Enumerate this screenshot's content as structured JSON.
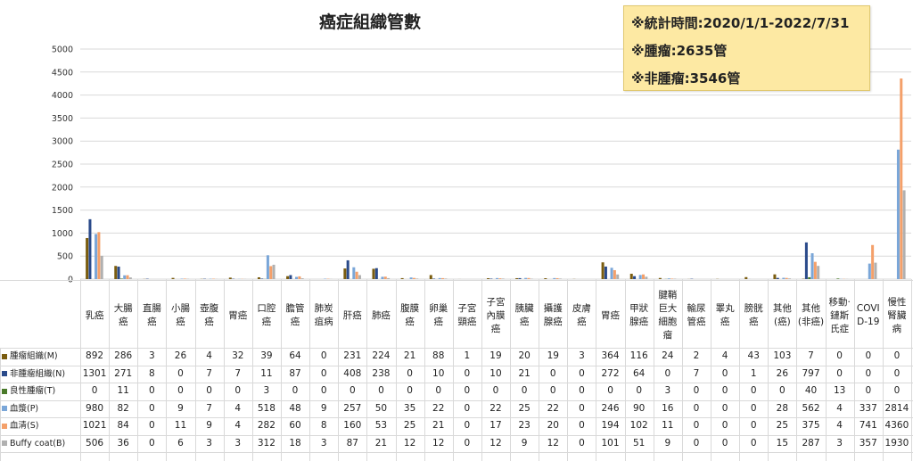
{
  "title": "癌症組織管數",
  "info": {
    "line1": "※統計時間:2020/1/1-2022/7/31",
    "line2": "※腫瘤:2635管",
    "line3": "※非腫瘤:3546管"
  },
  "chart_data": {
    "type": "bar",
    "title": "癌症組織管數",
    "ylim": [
      0,
      5000
    ],
    "yticks": [
      0,
      500,
      1000,
      1500,
      2000,
      2500,
      3000,
      3500,
      4000,
      4500,
      5000
    ],
    "grid": true,
    "legend": "table-left",
    "categories": [
      "乳癌",
      "大腸癌",
      "直腸癌",
      "小腸癌",
      "壺腹癌",
      "胃癌",
      "口腔癌",
      "膽管癌",
      "肺炭疽病",
      "肝癌",
      "肺癌",
      "腹膜癌",
      "卵巢癌",
      "子宮頸癌",
      "子宮內膜癌",
      "胰臟癌",
      "攝護腺癌",
      "皮膚癌",
      "胃癌",
      "甲狀腺癌",
      "腱鞘巨大細胞瘤",
      "輸尿管癌",
      "睪丸癌",
      "膀胱癌",
      "其他(癌)",
      "其他(非癌)",
      "移動·鏈斯氏症",
      "COVID-19",
      "慢性腎臟病"
    ],
    "category_lines": [
      [
        "乳癌"
      ],
      [
        "大腸",
        "癌"
      ],
      [
        "直腸",
        "癌"
      ],
      [
        "小腸",
        "癌"
      ],
      [
        "壺腹",
        "癌"
      ],
      [
        "胃癌"
      ],
      [
        "口腔",
        "癌"
      ],
      [
        "膽管",
        "癌"
      ],
      [
        "肺炭",
        "疽病"
      ],
      [
        "肝癌"
      ],
      [
        "肺癌"
      ],
      [
        "腹膜",
        "癌"
      ],
      [
        "卵巢",
        "癌"
      ],
      [
        "子宮",
        "頸癌"
      ],
      [
        "子宮",
        "內膜",
        "癌"
      ],
      [
        "胰臟",
        "癌"
      ],
      [
        "攝護",
        "腺癌"
      ],
      [
        "皮膚",
        "癌"
      ],
      [
        "胃癌"
      ],
      [
        "甲狀",
        "腺癌"
      ],
      [
        "腱鞘",
        "巨大",
        "細胞",
        "瘤"
      ],
      [
        "輸尿",
        "管癌"
      ],
      [
        "睪丸",
        "癌"
      ],
      [
        "膀胱",
        "癌"
      ],
      [
        "其他",
        "(癌)"
      ],
      [
        "其他",
        "(非癌)"
      ],
      [
        "移動·",
        "鏈斯",
        "氏症"
      ],
      [
        "COVI",
        "D-19"
      ],
      [
        "慢性",
        "腎臟",
        "病"
      ]
    ],
    "series": [
      {
        "name": "腫瘤組織(M)",
        "color": "#7a5c0f",
        "values": [
          892,
          286,
          3,
          26,
          4,
          32,
          39,
          64,
          0,
          231,
          224,
          21,
          88,
          1,
          19,
          20,
          19,
          3,
          364,
          116,
          24,
          2,
          4,
          43,
          103,
          7,
          0,
          0,
          0
        ]
      },
      {
        "name": "非腫瘤組織(N)",
        "color": "#2a4a8a",
        "values": [
          1301,
          271,
          8,
          0,
          7,
          7,
          11,
          87,
          0,
          408,
          238,
          0,
          10,
          0,
          10,
          21,
          0,
          0,
          272,
          64,
          0,
          7,
          0,
          1,
          26,
          797,
          0,
          0,
          0
        ]
      },
      {
        "name": "良性腫瘤(T)",
        "color": "#4a7a2a",
        "values": [
          0,
          11,
          0,
          0,
          0,
          0,
          3,
          0,
          0,
          0,
          0,
          0,
          0,
          0,
          0,
          0,
          0,
          0,
          0,
          0,
          3,
          0,
          0,
          0,
          0,
          40,
          13,
          0,
          0
        ]
      },
      {
        "name": "血漿(P)",
        "color": "#7aa6d8",
        "values": [
          980,
          82,
          0,
          9,
          7,
          4,
          518,
          48,
          9,
          257,
          50,
          35,
          22,
          0,
          22,
          25,
          22,
          0,
          246,
          90,
          16,
          0,
          0,
          0,
          28,
          562,
          4,
          337,
          2814
        ]
      },
      {
        "name": "血清(S)",
        "color": "#f4a06a",
        "values": [
          1021,
          84,
          0,
          11,
          9,
          4,
          282,
          60,
          8,
          160,
          53,
          25,
          21,
          0,
          17,
          23,
          20,
          0,
          194,
          102,
          11,
          0,
          0,
          0,
          25,
          375,
          4,
          741,
          4360
        ]
      },
      {
        "name": "Buffy coat(B)",
        "color": "#b0b0b0",
        "values": [
          506,
          36,
          0,
          6,
          3,
          3,
          312,
          18,
          3,
          87,
          21,
          12,
          12,
          0,
          12,
          9,
          12,
          0,
          101,
          51,
          9,
          0,
          0,
          0,
          15,
          287,
          3,
          357,
          1930
        ]
      }
    ]
  }
}
